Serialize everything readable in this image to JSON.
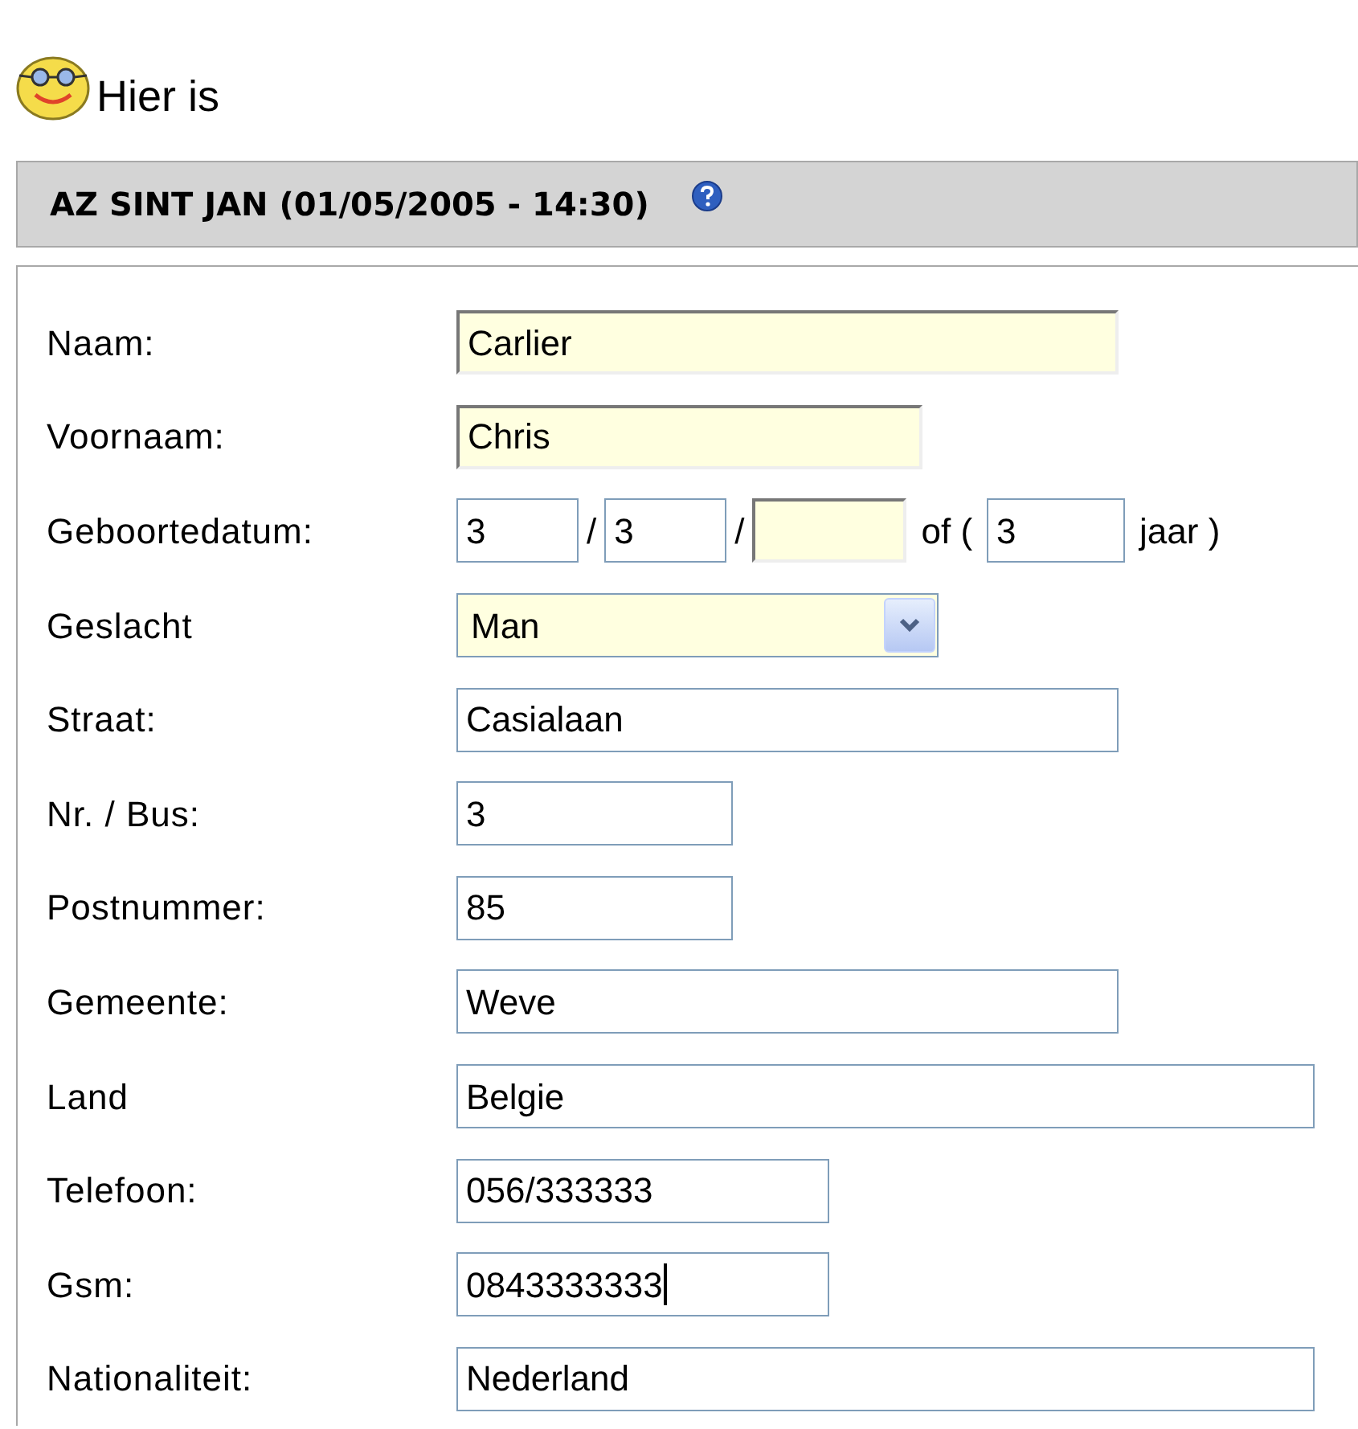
{
  "heading": "Hier is",
  "panel": {
    "title": "AZ SINT JAN (01/05/2005 - 14:30)"
  },
  "rows": [
    {
      "kind": "text",
      "label": "Naam:",
      "value": "Carlier",
      "highlighted": true,
      "focused": false
    },
    {
      "kind": "text",
      "label": "Voornaam:",
      "value": "Chris",
      "highlighted": true,
      "focused": false
    },
    {
      "kind": "date",
      "label": "Geboortedatum:",
      "day": "3",
      "month": "3",
      "year": "",
      "age": "3",
      "separator_1": "/",
      "separator_2": "/",
      "or_text": "of (",
      "unit_text": "jaar )",
      "year_highlighted": true
    },
    {
      "kind": "select",
      "label": "Geslacht",
      "value": "Man",
      "highlighted": true
    },
    {
      "kind": "text",
      "label": "Straat:",
      "value": "Casialaan",
      "highlighted": false,
      "focused": false
    },
    {
      "kind": "text",
      "label": "Nr. / Bus:",
      "value": "3",
      "highlighted": false,
      "focused": false
    },
    {
      "kind": "text",
      "label": "Postnummer:",
      "value": "85",
      "highlighted": false,
      "focused": false
    },
    {
      "kind": "text",
      "label": "Gemeente:",
      "value": "Weve",
      "highlighted": false,
      "focused": false
    },
    {
      "kind": "text",
      "label": "Land",
      "value": "Belgie",
      "highlighted": false,
      "focused": false
    },
    {
      "kind": "text",
      "label": "Telefoon:",
      "value": "056/333333",
      "highlighted": false,
      "focused": false
    },
    {
      "kind": "text",
      "label": "Gsm:",
      "value": "0843333333",
      "highlighted": false,
      "focused": true
    },
    {
      "kind": "text",
      "label": "Nationaliteit:",
      "value": "Nederland",
      "highlighted": false,
      "focused": false
    }
  ]
}
